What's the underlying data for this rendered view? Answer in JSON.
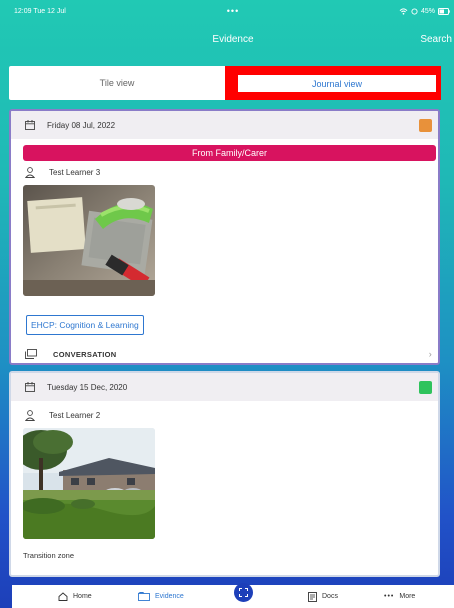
{
  "status_bar": {
    "time": "12:09  Tue 12 Jul",
    "dots": "•••",
    "battery": "45%"
  },
  "header": {
    "title": "Evidence",
    "search_label": "Search"
  },
  "view_toggle": {
    "tile_label": "Tile view",
    "journal_label": "Journal view",
    "selected": "Journal view"
  },
  "cards": [
    {
      "date": "Friday 08 Jul, 2022",
      "indicator_color": "#e8913a",
      "source_label": "From Family/Carer",
      "learner": "Test Learner 3",
      "tag": "EHCP: Cognition & Learning",
      "footer_label": "CONVERSATION",
      "chevron": "›"
    },
    {
      "date": "Tuesday 15 Dec, 2020",
      "indicator_color": "#2fc35c",
      "learner": "Test Learner 2",
      "caption": "Transition zone"
    }
  ],
  "tab_bar": {
    "items": [
      {
        "label": "Home",
        "icon": "home-icon"
      },
      {
        "label": "Evidence",
        "icon": "evidence-icon",
        "active": true
      },
      {
        "label": "",
        "icon": "scan-icon"
      },
      {
        "label": "Docs",
        "icon": "docs-icon"
      },
      {
        "label": "More",
        "icon": "more-icon"
      }
    ],
    "more_dots": "•••"
  },
  "colors": {
    "accent": "#2e77d0",
    "source_badge": "#d8135f",
    "highlight": "#ff0000"
  }
}
